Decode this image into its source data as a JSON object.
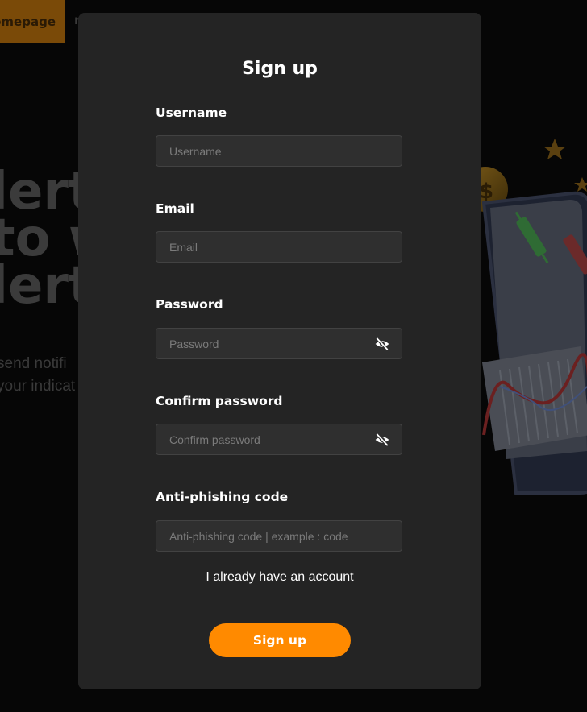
{
  "background": {
    "nav": {
      "homepage": "omepage",
      "next_item": "r"
    },
    "hero": {
      "line1": "lert",
      "line2": "to w",
      "line3": "lert"
    },
    "sub": {
      "line1": "send notifi",
      "line2": "your indicat"
    }
  },
  "modal": {
    "title": "Sign up",
    "fields": {
      "username": {
        "label": "Username",
        "placeholder": "Username",
        "value": ""
      },
      "email": {
        "label": "Email",
        "placeholder": "Email",
        "value": ""
      },
      "password": {
        "label": "Password",
        "placeholder": "Password",
        "value": "",
        "toggle_icon": "eye-slash-icon"
      },
      "confirm_password": {
        "label": "Confirm password",
        "placeholder": "Confirm password",
        "value": "",
        "toggle_icon": "eye-slash-icon"
      },
      "anti_phishing": {
        "label": "Anti-phishing code",
        "placeholder": "Anti-phishing code | example : code",
        "value": ""
      }
    },
    "login_link": "I already have an account",
    "submit_label": "Sign up"
  },
  "colors": {
    "accent": "#ff8a00",
    "modal_bg": "#242424",
    "input_bg": "#2f2f2f",
    "page_bg": "#060606"
  }
}
